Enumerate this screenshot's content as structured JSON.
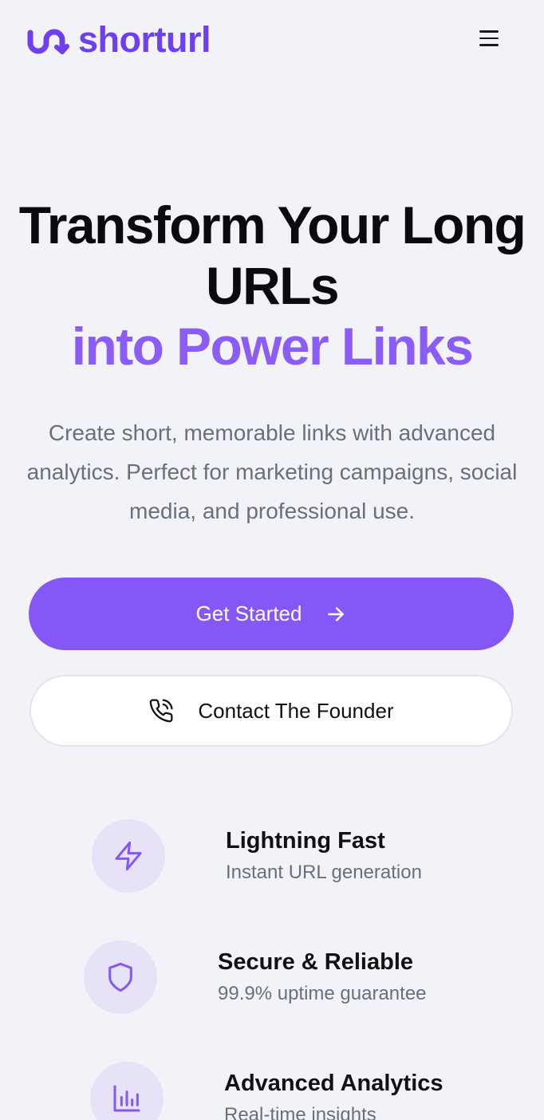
{
  "header": {
    "brand": "shorturl",
    "logo_icon": "link-swirl-icon",
    "menu_icon": "hamburger-menu-icon"
  },
  "hero": {
    "title_line1": "Transform Your Long",
    "title_line2": "URLs",
    "title_accent": "into Power Links",
    "subtitle": "Create short, memorable links with advanced analytics. Perfect for marketing campaigns, social media, and professional use."
  },
  "actions": {
    "primary": {
      "label": "Get Started",
      "icon": "arrow-right-icon"
    },
    "secondary": {
      "label": "Contact The Founder",
      "icon": "phone-call-icon"
    }
  },
  "features": [
    {
      "title": "Lightning Fast",
      "description": "Instant URL generation",
      "icon": "lightning-bolt-icon"
    },
    {
      "title": "Secure & Reliable",
      "description": "99.9% uptime guarantee",
      "icon": "shield-icon"
    },
    {
      "title": "Advanced Analytics",
      "description": "Real-time insights",
      "icon": "bar-chart-icon"
    }
  ],
  "colors": {
    "brand": "#6d3ff0",
    "accent": "#8b5cf6",
    "primary_button": "#8457f6",
    "background": "#f1f3f8",
    "icon_circle": "#e7e2f8"
  }
}
